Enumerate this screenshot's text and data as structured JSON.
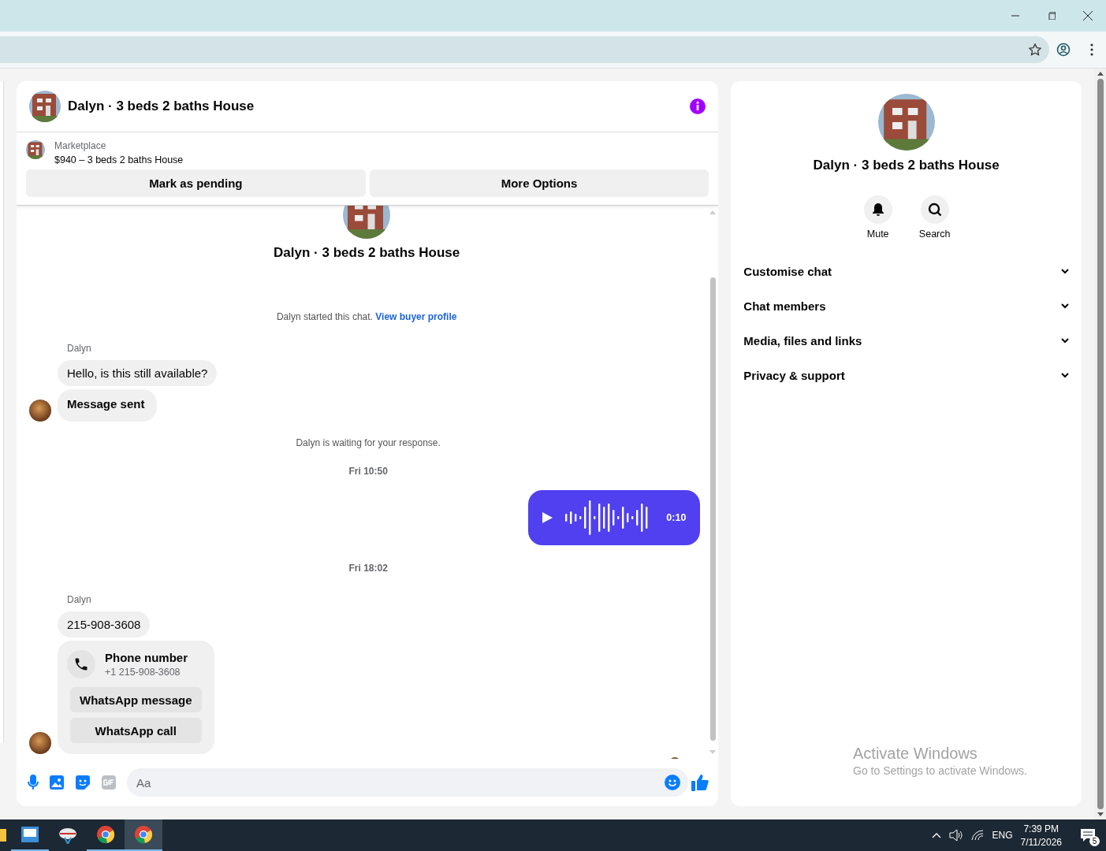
{
  "chat": {
    "header": {
      "title": "Dalyn · 3 beds 2 baths House"
    },
    "listing": {
      "source": "Marketplace",
      "title": "$940 – 3 beds 2 baths House",
      "actions": [
        "Mark as pending",
        "More Options"
      ]
    },
    "intro": {
      "title": "Dalyn · 3 beds 2 baths House",
      "notice": "Dalyn started this chat.",
      "link": "View buyer profile"
    },
    "messages": [
      {
        "kind": "name",
        "text": "Dalyn"
      },
      {
        "kind": "bubble",
        "text": "Hello, is this still available?",
        "emphasis": false,
        "avatar": false
      },
      {
        "kind": "bubble",
        "text": "Message sent",
        "emphasis": true,
        "avatar": true
      },
      {
        "kind": "notice",
        "text": "Dalyn is waiting for your response."
      },
      {
        "kind": "time",
        "text": "Fri 10:50"
      },
      {
        "kind": "voice",
        "duration": "0:10"
      },
      {
        "kind": "time",
        "text": "Fri 18:02"
      },
      {
        "kind": "name",
        "text": "Dalyn"
      },
      {
        "kind": "bubble",
        "text": "215-908-3608",
        "emphasis": false,
        "avatar": false
      },
      {
        "kind": "contact",
        "title": "Phone number",
        "number": "+1 215-908-3608",
        "buttons": [
          "WhatsApp message",
          "WhatsApp call"
        ],
        "avatar": true
      }
    ],
    "composer": {
      "placeholder": "Aa"
    }
  },
  "panel": {
    "title": "Dalyn · 3 beds 2 baths House",
    "actions": [
      {
        "kind": "bell",
        "label": "Mute"
      },
      {
        "kind": "search",
        "label": "Search"
      }
    ],
    "sections": [
      {
        "label": "Customise chat",
        "expanded": false
      },
      {
        "label": "Chat members",
        "expanded": false
      },
      {
        "label": "Media, files and links",
        "expanded": false
      },
      {
        "label": "Privacy & support",
        "expanded": false
      }
    ]
  },
  "watermark": {
    "title": "Activate Windows",
    "subtitle": "Go to Settings to activate Windows."
  },
  "taskbar": {
    "language": "ENG",
    "time": "7:39 PM",
    "date": "7/11/2026",
    "notifications": "5"
  }
}
